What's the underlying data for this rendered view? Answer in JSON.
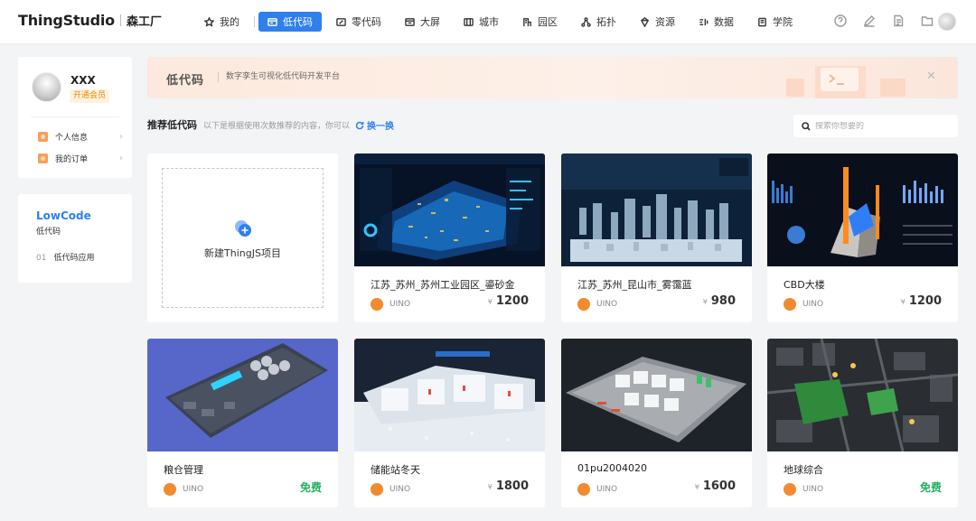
{
  "header": {
    "logo": "ThingStudio",
    "logo_sub": "森工厂",
    "nav": [
      {
        "label": "我的",
        "icon": "star-icon",
        "active": false
      },
      {
        "label": "低代码",
        "icon": "lowcode-icon",
        "active": true
      },
      {
        "label": "零代码",
        "icon": "nocode-icon",
        "active": false
      },
      {
        "label": "大屏",
        "icon": "screen-icon",
        "active": false
      },
      {
        "label": "城市",
        "icon": "city-icon",
        "active": false
      },
      {
        "label": "园区",
        "icon": "park-icon",
        "active": false
      },
      {
        "label": "拓扑",
        "icon": "topology-icon",
        "active": false
      },
      {
        "label": "资源",
        "icon": "resource-icon",
        "active": false
      },
      {
        "label": "数据",
        "icon": "data-icon",
        "active": false
      },
      {
        "label": "学院",
        "icon": "academy-icon",
        "active": false
      }
    ],
    "tools": [
      "help-icon",
      "edit-icon",
      "document-icon",
      "folder-icon"
    ]
  },
  "user": {
    "name": "XXX",
    "vip_label": "开通会员",
    "menu": [
      {
        "label": "个人信息"
      },
      {
        "label": "我的订单"
      }
    ]
  },
  "lowcode_panel": {
    "title": "LowCode",
    "subtitle": "低代码",
    "items": [
      {
        "num": "01",
        "label": "低代码应用"
      }
    ]
  },
  "banner": {
    "title": "低代码",
    "description": "数字孪生可视化低代码开发平台"
  },
  "section": {
    "title": "推荐低代码",
    "hint": "以下是根据使用次数推荐的内容，你可以",
    "refresh_label": "换一换"
  },
  "search": {
    "placeholder": "搜索你想要的",
    "value": ""
  },
  "new_project": {
    "label": "新建ThingJS项目"
  },
  "cards": [
    {
      "title": "江苏_苏州_苏州工业园区_鎏砂金",
      "brand": "UINO",
      "currency": "¥",
      "price": "1200",
      "free": false
    },
    {
      "title": "江苏_苏州_昆山市_雾霭蓝",
      "brand": "UINO",
      "currency": "¥",
      "price": "980",
      "free": false
    },
    {
      "title": "CBD大楼",
      "brand": "UINO",
      "currency": "¥",
      "price": "1200",
      "free": false
    },
    {
      "title": "粮仓管理",
      "brand": "UINO",
      "currency": "",
      "price": "免费",
      "free": true
    },
    {
      "title": "储能站冬天",
      "brand": "UINO",
      "currency": "¥",
      "price": "1800",
      "free": false
    },
    {
      "title": "01pu2004020",
      "brand": "UINO",
      "currency": "¥",
      "price": "1600",
      "free": false
    },
    {
      "title": "地球综合",
      "brand": "UINO",
      "currency": "",
      "price": "免费",
      "free": true
    }
  ],
  "colors": {
    "accent": "#2f80ed",
    "free": "#22b35e",
    "vip": "#e88a00",
    "brand": "#f28a2f"
  }
}
